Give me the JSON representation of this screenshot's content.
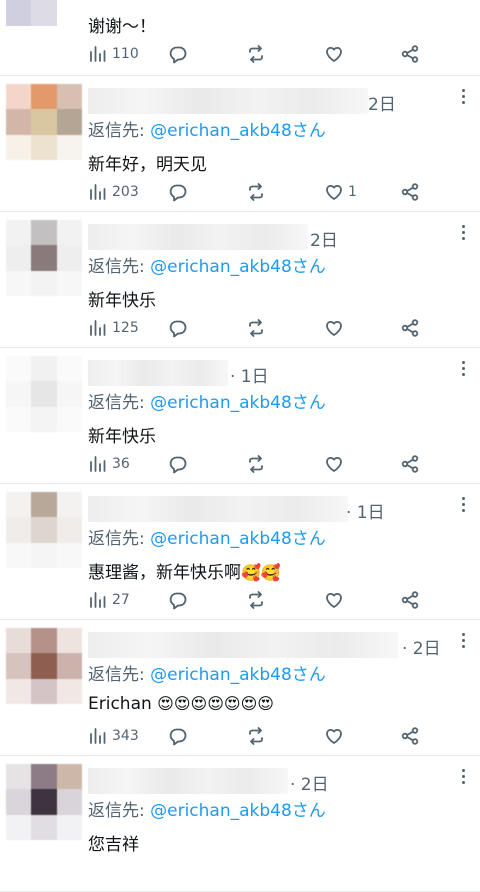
{
  "posts": [
    {
      "time": "",
      "reply_prefix": "",
      "reply_handle": "",
      "text": "谢谢～！",
      "views": "110",
      "likes": "",
      "avatar": [
        "#ffffff",
        "#ffffff",
        "#ffffff",
        "#ffffff",
        "#ffffff",
        "#ffffff",
        "#ffffff",
        "#ffffff",
        "#ffffff"
      ],
      "avatar_top_strip": [
        "#d0cfe0",
        "#dcdbe6",
        "#ffffff"
      ]
    },
    {
      "time": "2日",
      "reply_prefix": "返信先: ",
      "reply_handle": "@erichan_akb48さん",
      "text": "新年好，明天见",
      "views": "203",
      "likes": "1",
      "avatar": [
        "#f3d6c9",
        "#e29a6a",
        "#d7c0b2",
        "#d3b6a8",
        "#d9c7a1",
        "#b5a594",
        "#f8f1e8",
        "#ece2cf",
        "#f7f3ee"
      ]
    },
    {
      "time": "2日",
      "reply_prefix": "返信先: ",
      "reply_handle": "@erichan_akb48さん",
      "text": "新年快乐",
      "views": "125",
      "likes": "",
      "avatar": [
        "#f2f2f2",
        "#c3c0c2",
        "#f2f2f2",
        "#eeeeee",
        "#8b7a7c",
        "#eeeeee",
        "#f7f7f7",
        "#f3f3f3",
        "#f7f7f7"
      ]
    },
    {
      "time": "· 1日",
      "reply_prefix": "返信先: ",
      "reply_handle": "@erichan_akb48さん",
      "text": "新年快乐",
      "views": "36",
      "likes": "",
      "avatar": [
        "#fafafa",
        "#f1f1f1",
        "#fafafa",
        "#f6f6f6",
        "#e6e6e6",
        "#f6f6f6",
        "#fafafa",
        "#f4f4f4",
        "#fafafa"
      ]
    },
    {
      "time": "· 1日",
      "reply_prefix": "返信先: ",
      "reply_handle": "@erichan_akb48さん",
      "text": "惠理酱，新年快乐啊",
      "emojis": "🥰🥰",
      "views": "27",
      "likes": "",
      "avatar": [
        "#f4f2f0",
        "#b8a89a",
        "#f4f2f0",
        "#f0ecea",
        "#ddd6cf",
        "#f0ecea",
        "#f8f8f8",
        "#f5f5f5",
        "#f8f8f8"
      ]
    },
    {
      "time": "· 2日",
      "reply_prefix": "返信先: ",
      "reply_handle": "@erichan_akb48さん",
      "text": "Erichan ",
      "emojis": "😍😍😍😍😍😍😍",
      "views": "343",
      "likes": "",
      "avatar": [
        "#e8dcd9",
        "#b49289",
        "#efe3e0",
        "#d7c3bd",
        "#8e5f50",
        "#cbb2aa",
        "#f1e8e6",
        "#d4c4c6",
        "#f1e8e6"
      ]
    },
    {
      "time": "· 2日",
      "reply_prefix": "返信先: ",
      "reply_handle": "@erichan_akb48さん",
      "text": "您吉祥",
      "views": "",
      "likes": "",
      "avatar": [
        "#e6e3e5",
        "#8d7c86",
        "#cdb7a8",
        "#d9d5db",
        "#3d3440",
        "#d8d4d9",
        "#f2f1f3",
        "#e1dee3",
        "#f2f1f3"
      ]
    }
  ],
  "icons": {
    "views": "bar-chart-icon",
    "reply": "speech-bubble-icon",
    "repost": "repost-arrows-icon",
    "like": "heart-icon",
    "share": "share-icon",
    "more": "more-dots-icon"
  },
  "colors": {
    "text": "#0f1419",
    "muted": "#536471",
    "link": "#1d9bf0",
    "divider": "#e6e8eb"
  }
}
